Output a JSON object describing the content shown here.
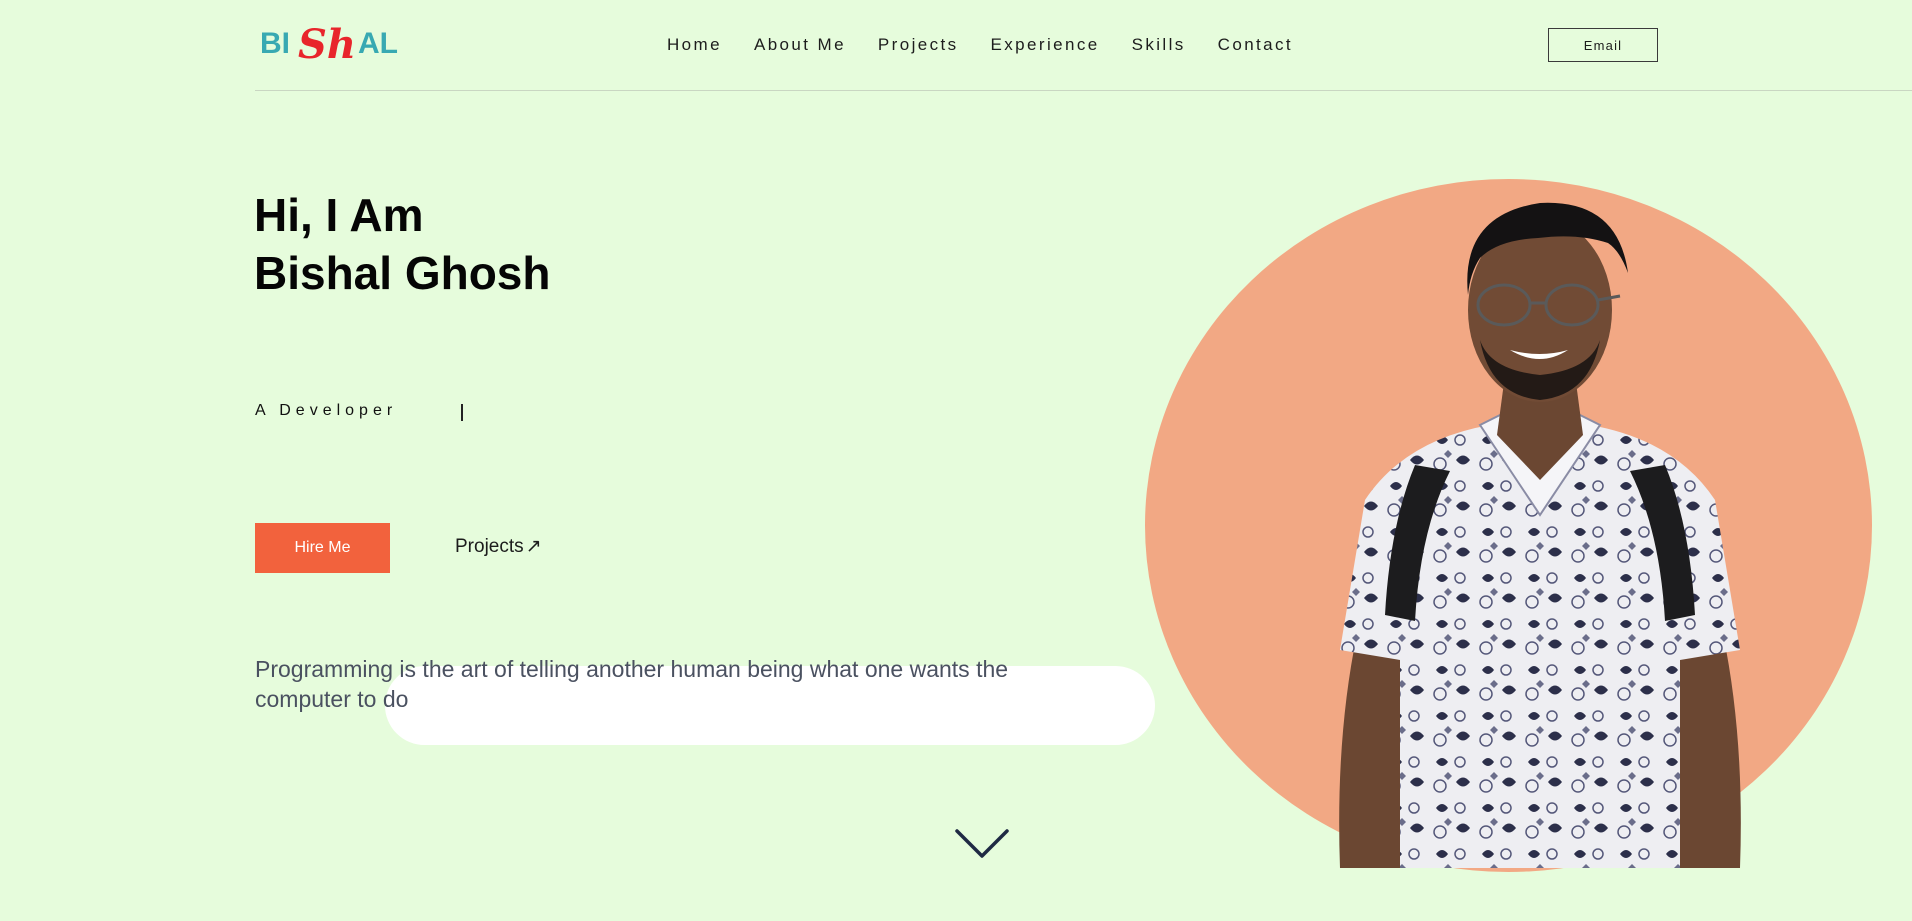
{
  "header": {
    "logo": {
      "letters_left": "BI",
      "script": "Sh",
      "letters_right": "AL"
    },
    "nav": [
      "Home",
      "About Me",
      "Projects",
      "Experience",
      "Skills",
      "Contact"
    ],
    "email_label": "Email"
  },
  "hero": {
    "greeting": "Hi, I Am",
    "name": "Bishal Ghosh",
    "role": "A Developer",
    "hire_label": "Hire Me",
    "projects_label": "Projects",
    "projects_arrow": "↗",
    "quote": "Programming is the art of telling another human being what one wants the computer to do"
  },
  "colors": {
    "background": "#e6fcdc",
    "accent": "#f2623d",
    "portrait_circle": "#f2a884",
    "logo_teal": "#38a9b2",
    "logo_red": "#e8252b"
  },
  "icons": {
    "scroll": "chevron-down-icon",
    "external": "arrow-up-right-icon"
  }
}
